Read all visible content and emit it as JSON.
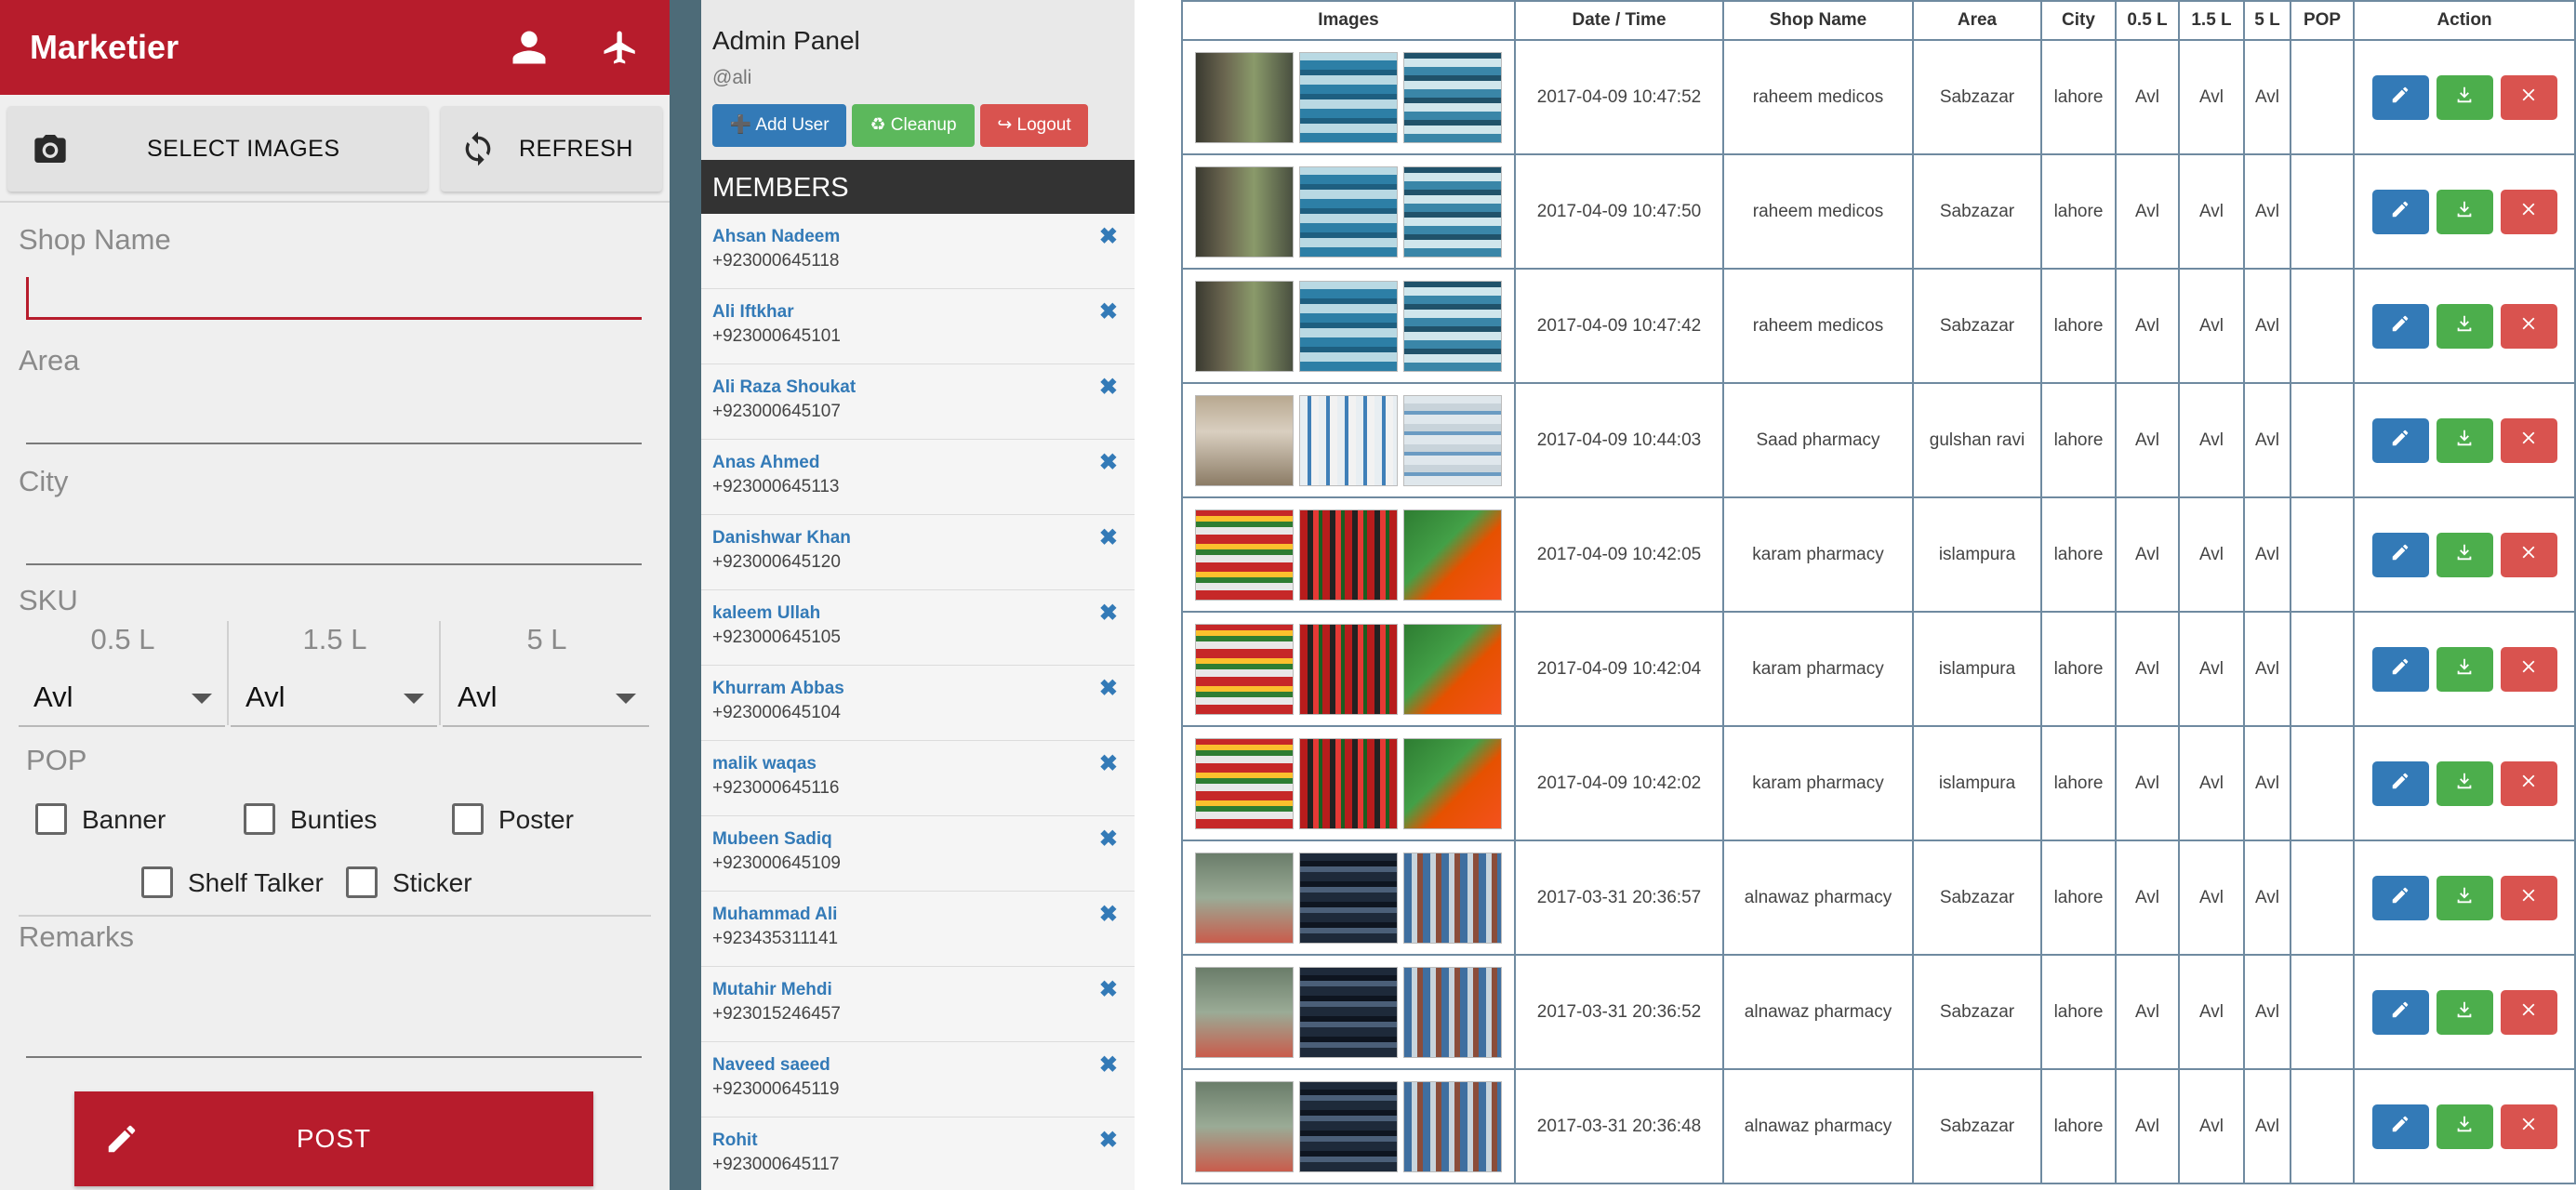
{
  "app": {
    "title": "Marketier",
    "select_images_label": "SELECT IMAGES",
    "refresh_label": "REFRESH",
    "shop_name_label": "Shop Name",
    "area_label": "Area",
    "city_label": "City",
    "sku_label": "SKU",
    "sku_columns": [
      {
        "label": "0.5 L",
        "value": "Avl"
      },
      {
        "label": "1.5 L",
        "value": "Avl"
      },
      {
        "label": "5 L",
        "value": "Avl"
      }
    ],
    "pop_label": "POP",
    "pop_options": [
      "Banner",
      "Bunties",
      "Poster",
      "Shelf Talker",
      "Sticker"
    ],
    "remarks_label": "Remarks",
    "post_label": "POST",
    "colors": {
      "primary": "#b71c2c",
      "background": "#efefef"
    },
    "icons": {
      "profile": "person-icon",
      "flight": "airplane-icon",
      "camera": "camera-icon",
      "refresh": "refresh-icon",
      "post": "pencil-icon"
    }
  },
  "admin": {
    "title": "Admin Panel",
    "username": "@ali",
    "buttons": {
      "add_user": "Add User",
      "cleanup": "Cleanup",
      "logout": "Logout"
    },
    "members_heading": "MEMBERS",
    "members": [
      {
        "name": "Ahsan Nadeem",
        "phone": "+923000645118"
      },
      {
        "name": "Ali Iftkhar",
        "phone": "+923000645101"
      },
      {
        "name": "Ali Raza Shoukat",
        "phone": "+923000645107"
      },
      {
        "name": "Anas Ahmed",
        "phone": "+923000645113"
      },
      {
        "name": "Danishwar Khan",
        "phone": "+923000645120"
      },
      {
        "name": "kaleem Ullah",
        "phone": "+923000645105"
      },
      {
        "name": "Khurram Abbas",
        "phone": "+923000645104"
      },
      {
        "name": "malik waqas",
        "phone": "+923000645116"
      },
      {
        "name": "Mubeen Sadiq",
        "phone": "+923000645109"
      },
      {
        "name": "Muhammad Ali",
        "phone": "+923435311141"
      },
      {
        "name": "Mutahir Mehdi",
        "phone": "+923015246457"
      },
      {
        "name": "Naveed saeed",
        "phone": "+923000645119"
      },
      {
        "name": "Rohit",
        "phone": "+923000645117"
      }
    ],
    "delete_glyph": "✖"
  },
  "table": {
    "columns": [
      "Images",
      "Date / Time",
      "Shop Name",
      "Area",
      "City",
      "0.5 L",
      "1.5 L",
      "5 L",
      "POP",
      "Action"
    ],
    "rows": [
      {
        "images": "medicos",
        "datetime": "2017-04-09 10:47:52",
        "shop": "raheem medicos",
        "area": "Sabzazar",
        "city": "lahore",
        "s05": "Avl",
        "s15": "Avl",
        "s5": "Avl",
        "pop": ""
      },
      {
        "images": "medicos",
        "datetime": "2017-04-09 10:47:50",
        "shop": "raheem medicos",
        "area": "Sabzazar",
        "city": "lahore",
        "s05": "Avl",
        "s15": "Avl",
        "s5": "Avl",
        "pop": ""
      },
      {
        "images": "medicos",
        "datetime": "2017-04-09 10:47:42",
        "shop": "raheem medicos",
        "area": "Sabzazar",
        "city": "lahore",
        "s05": "Avl",
        "s15": "Avl",
        "s5": "Avl",
        "pop": ""
      },
      {
        "images": "saad",
        "datetime": "2017-04-09 10:44:03",
        "shop": "Saad pharmacy",
        "area": "gulshan ravi",
        "city": "lahore",
        "s05": "Avl",
        "s15": "Avl",
        "s5": "Avl",
        "pop": ""
      },
      {
        "images": "karam",
        "datetime": "2017-04-09 10:42:05",
        "shop": "karam pharmacy",
        "area": "islampura",
        "city": "lahore",
        "s05": "Avl",
        "s15": "Avl",
        "s5": "Avl",
        "pop": ""
      },
      {
        "images": "karam",
        "datetime": "2017-04-09 10:42:04",
        "shop": "karam pharmacy",
        "area": "islampura",
        "city": "lahore",
        "s05": "Avl",
        "s15": "Avl",
        "s5": "Avl",
        "pop": ""
      },
      {
        "images": "karam",
        "datetime": "2017-04-09 10:42:02",
        "shop": "karam pharmacy",
        "area": "islampura",
        "city": "lahore",
        "s05": "Avl",
        "s15": "Avl",
        "s5": "Avl",
        "pop": ""
      },
      {
        "images": "alnawaz",
        "datetime": "2017-03-31 20:36:57",
        "shop": "alnawaz pharmacy",
        "area": "Sabzazar",
        "city": "lahore",
        "s05": "Avl",
        "s15": "Avl",
        "s5": "Avl",
        "pop": ""
      },
      {
        "images": "alnawaz",
        "datetime": "2017-03-31 20:36:52",
        "shop": "alnawaz pharmacy",
        "area": "Sabzazar",
        "city": "lahore",
        "s05": "Avl",
        "s15": "Avl",
        "s5": "Avl",
        "pop": ""
      },
      {
        "images": "alnawaz",
        "datetime": "2017-03-31 20:36:48",
        "shop": "alnawaz pharmacy",
        "area": "Sabzazar",
        "city": "lahore",
        "s05": "Avl",
        "s15": "Avl",
        "s5": "Avl",
        "pop": ""
      }
    ],
    "action_icons": [
      "pencil-icon",
      "download-icon",
      "close-icon"
    ],
    "colors": {
      "edit": "#337ab7",
      "download": "#4cae4c",
      "delete": "#d9534f",
      "border": "#6f8aa0"
    }
  }
}
